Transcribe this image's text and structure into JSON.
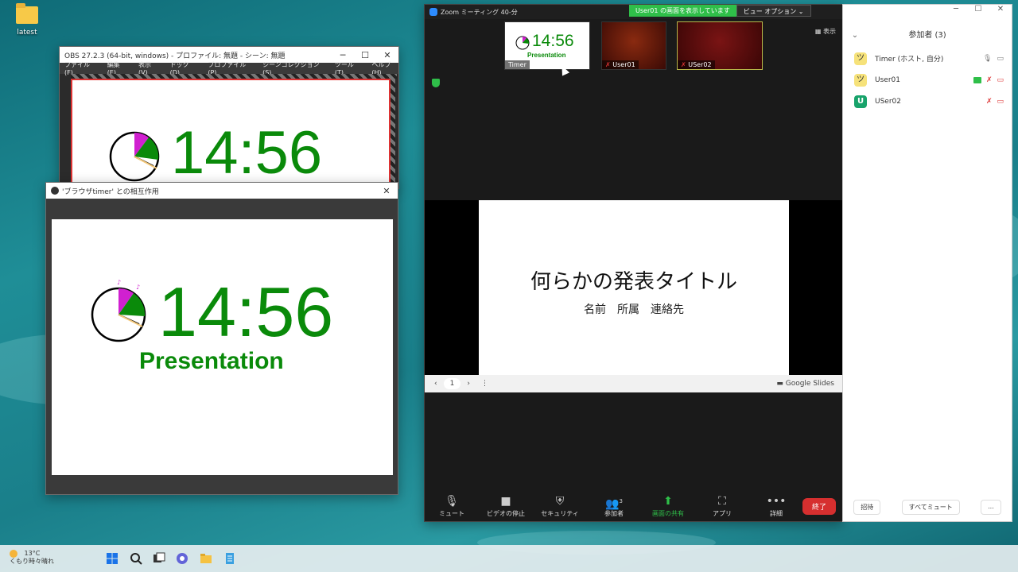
{
  "desktop": {
    "folder_label": "latest"
  },
  "obs": {
    "title": "OBS 27.2.3 (64-bit, windows) - プロファイル: 無題 - シーン: 無題",
    "menu": [
      "ファイル(F)",
      "編集(E)",
      "表示(V)",
      "ドック(D)",
      "プロファイル(P)",
      "シーンコレクション(S)",
      "ツール(T)",
      "ヘルプ(H)"
    ],
    "timer_value": "14:56"
  },
  "interact": {
    "title": "'ブラウザtimer' との相互作用",
    "timer_value": "14:56",
    "timer_label": "Presentation"
  },
  "zoom": {
    "title": "Zoom ミーティング 40-分",
    "share_banner": "User01 の画面を表示しています",
    "view_options": "ビュー オプション ⌄",
    "view_button": "表示",
    "thumbnails": [
      {
        "name": "Timer",
        "timer_value": "14:56",
        "timer_label": "Presentation"
      },
      {
        "name": "User01"
      },
      {
        "name": "USer02"
      }
    ],
    "slide": {
      "title": "何らかの発表タイトル",
      "subtitle": "名前　所属　連絡先"
    },
    "slide_bar": {
      "page": "1",
      "brand": "Google Slides"
    },
    "toolbar": [
      {
        "icon": "mic-icon",
        "label": "ミュート"
      },
      {
        "icon": "video-icon",
        "label": "ビデオの停止"
      },
      {
        "icon": "security-icon",
        "label": "セキュリティ"
      },
      {
        "icon": "participants-icon",
        "label": "参加者",
        "badge": "3"
      },
      {
        "icon": "share-screen-icon",
        "label": "画面の共有"
      },
      {
        "icon": "apps-icon",
        "label": "アプリ"
      },
      {
        "icon": "more-icon",
        "label": "詳細"
      }
    ],
    "end_label": "終了"
  },
  "participants": {
    "title": "参加者 (3)",
    "list": [
      {
        "name": "Timer (ホスト, 自分)",
        "avatar": "emoji"
      },
      {
        "name": "User01",
        "avatar": "emoji"
      },
      {
        "name": "USer02",
        "avatar": "U"
      }
    ],
    "footer": [
      "招待",
      "すべてミュート",
      "..."
    ]
  },
  "taskbar": {
    "weather_temp": "13°C",
    "weather_desc": "くもり時々晴れ"
  },
  "colors": {
    "timer_green": "#0a8a0a",
    "timer_magenta": "#d020d0",
    "zoom_green": "#2fbf49",
    "end_red": "#d62f2f"
  }
}
